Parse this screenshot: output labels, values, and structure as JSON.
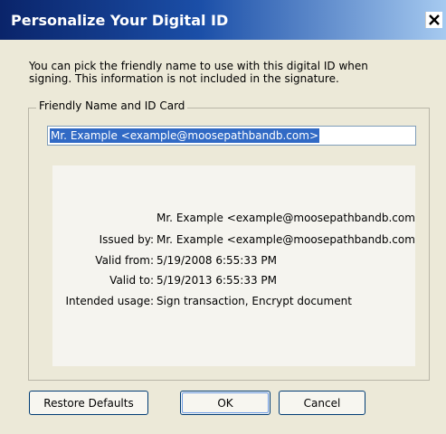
{
  "window": {
    "title": "Personalize Your Digital ID",
    "close_glyph": "×"
  },
  "intro_text": "You can pick the friendly name to use with this digital ID when signing. This information is not included in the signature.",
  "group": {
    "label": "Friendly Name and ID Card",
    "friendly_name_value": "Mr. Example <example@moosepathbandb.com>"
  },
  "id_card": {
    "name_line": "Mr. Example <example@moosepathbandb.com",
    "issued_by_label": "Issued by:",
    "issued_by_value": "Mr. Example <example@moosepathbandb.com",
    "valid_from_label": "Valid from:",
    "valid_from_value": "5/19/2008 6:55:33 PM",
    "valid_to_label": "Valid to:",
    "valid_to_value": "5/19/2013 6:55:33 PM",
    "usage_label": "Intended usage:",
    "usage_value": "Sign transaction, Encrypt document"
  },
  "buttons": {
    "restore_label": "Restore Defaults",
    "ok_label": "OK",
    "cancel_label": "Cancel"
  },
  "colors": {
    "title_bar": "#0a246a",
    "selection": "#316ac5",
    "dialog_bg": "#ece9d8"
  }
}
